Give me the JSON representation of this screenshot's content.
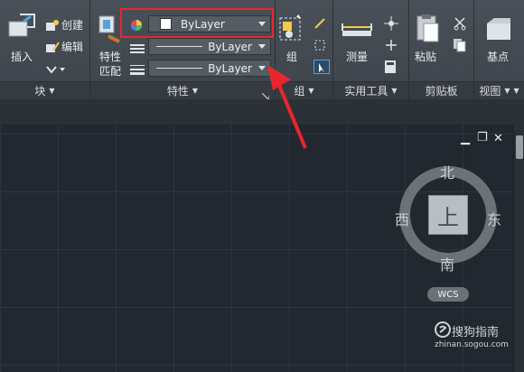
{
  "block_panel": {
    "insert_label": "插入",
    "create_label": "创建",
    "edit_label": "编辑",
    "footer_label": "块"
  },
  "properties_panel": {
    "match_label_line1": "特性",
    "match_label_line2": "匹配",
    "color_value": "ByLayer",
    "linetype_value": "ByLayer",
    "lineweight_value": "ByLayer",
    "footer_label": "特性"
  },
  "group_panel": {
    "group_label": "组",
    "footer_label": "组"
  },
  "utilities_panel": {
    "measure_label": "测量",
    "footer_label": "实用工具"
  },
  "clipboard_panel": {
    "paste_label": "粘贴",
    "footer_label": "剪贴板"
  },
  "view_panel": {
    "basepoint_label": "基点",
    "footer_label": "视图"
  },
  "viewcube": {
    "north": "北",
    "south": "南",
    "east": "东",
    "west": "西",
    "top_face": "上",
    "wcs_label": "WCS",
    "minimize_symbol": "▁",
    "restore_symbol": "❐",
    "close_symbol": "✕"
  },
  "watermark": {
    "brand": "搜狗指南",
    "url": "zhinan.sogou.com"
  },
  "colors": {
    "annotation_red": "#e8262b",
    "ribbon_bg": "#444a51",
    "canvas_bg": "#212830"
  }
}
